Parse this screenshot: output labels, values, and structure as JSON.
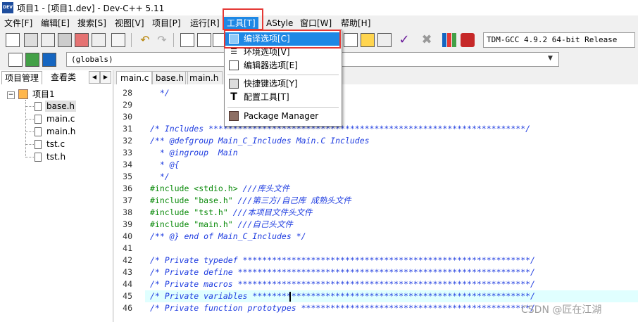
{
  "window": {
    "title": "项目1 - [项目1.dev] - Dev-C++ 5.11",
    "app_icon_text": "DEV"
  },
  "menubar": [
    {
      "label": "文件[F]"
    },
    {
      "label": "编辑[E]"
    },
    {
      "label": "搜索[S]"
    },
    {
      "label": "视图[V]"
    },
    {
      "label": "项目[P]"
    },
    {
      "label": "运行[R]"
    },
    {
      "label": "工具[T]"
    },
    {
      "label": "AStyle"
    },
    {
      "label": "窗口[W]"
    },
    {
      "label": "帮助[H]"
    }
  ],
  "toolbar": {
    "compiler": "TDM-GCC 4.9.2 64-bit Release",
    "scope": "(globals)"
  },
  "tools_menu": [
    {
      "label": "编译选项[C]",
      "icon": "compile-options-icon"
    },
    {
      "label": "环境选项[V]",
      "icon": "environment-options-icon"
    },
    {
      "label": "编辑器选项[E]",
      "icon": "editor-options-icon"
    },
    {
      "label": "快捷键选项[Y]",
      "icon": "shortcut-options-icon"
    },
    {
      "label": "配置工具[T]",
      "icon": "configure-tools-icon"
    },
    {
      "label": "Package Manager",
      "icon": "package-manager-icon"
    }
  ],
  "left_panel": {
    "tabs": [
      {
        "label": "项目管理"
      },
      {
        "label": "查看类"
      }
    ],
    "project": "项目1",
    "files": [
      {
        "name": "base.h"
      },
      {
        "name": "main.c"
      },
      {
        "name": "main.h"
      },
      {
        "name": "tst.c"
      },
      {
        "name": "tst.h"
      }
    ]
  },
  "editor_tabs": [
    {
      "label": "main.c"
    },
    {
      "label": "base.h"
    },
    {
      "label": "main.h"
    }
  ],
  "code_lines": [
    {
      "n": "28",
      "text": "  */",
      "kind": "cmt"
    },
    {
      "n": "29",
      "text": "",
      "kind": "plain"
    },
    {
      "n": "30",
      "text": "",
      "kind": "plain"
    },
    {
      "n": "31",
      "text": "/* Includes *****************************************************************/",
      "kind": "cmt"
    },
    {
      "n": "32",
      "text": "/** @defgroup Main_C_Includes Main.C Includes",
      "kind": "cmt"
    },
    {
      "n": "33",
      "text": "  * @ingroup  Main",
      "kind": "cmt"
    },
    {
      "n": "34",
      "text": "  * @{",
      "kind": "cmt"
    },
    {
      "n": "35",
      "text": "  */",
      "kind": "cmt"
    },
    {
      "n": "36",
      "text": "#include <stdio.h> ",
      "kind": "pp",
      "comment": "///库头文件"
    },
    {
      "n": "37",
      "text": "#include \"base.h\" ",
      "kind": "pp",
      "comment": "///第三方/自己库 成熟头文件"
    },
    {
      "n": "38",
      "text": "#include \"tst.h\" ",
      "kind": "pp",
      "comment": "///本项目文件头文件"
    },
    {
      "n": "39",
      "text": "#include \"main.h\" ",
      "kind": "pp",
      "comment": "///自己头文件"
    },
    {
      "n": "40",
      "text": "/** @} end of Main_C_Includes */",
      "kind": "cmt"
    },
    {
      "n": "41",
      "text": "",
      "kind": "plain"
    },
    {
      "n": "42",
      "text": "/* Private typedef ***********************************************************/",
      "kind": "cmt"
    },
    {
      "n": "43",
      "text": "/* Private define ************************************************************/",
      "kind": "cmt"
    },
    {
      "n": "44",
      "text": "/* Private macros ************************************************************/",
      "kind": "cmt"
    },
    {
      "n": "45",
      "text": "/* Private variables *********************************************************/",
      "kind": "cmt"
    },
    {
      "n": "46",
      "text": "/* Private function prototypes ***********************************************/",
      "kind": "cmt"
    }
  ],
  "watermark": "CSDN @匠在江湖"
}
